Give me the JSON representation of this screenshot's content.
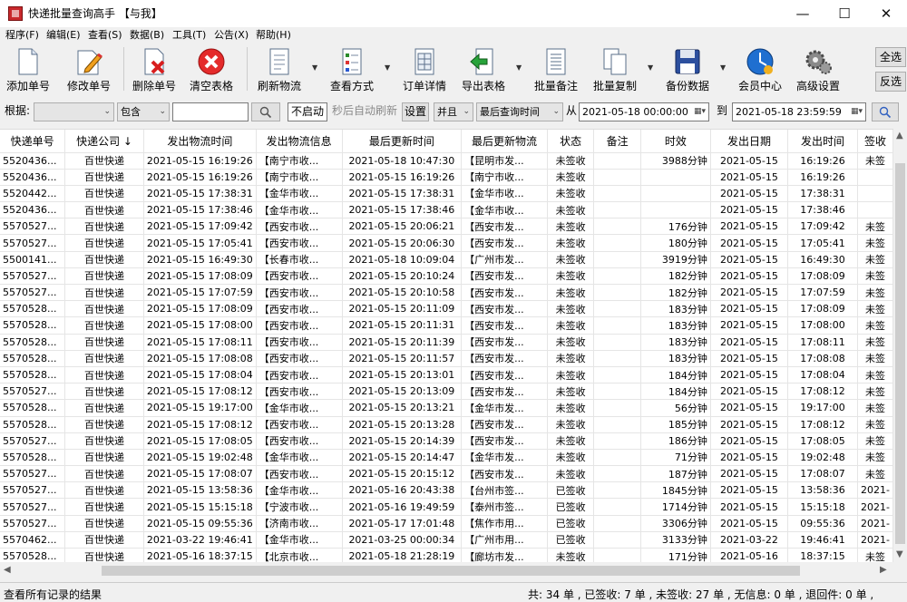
{
  "window": {
    "title": "快递批量查询高手 【与我】",
    "min_glyph": "—",
    "max_glyph": "☐",
    "close_glyph": "✕"
  },
  "menu": [
    "程序(F)",
    "编辑(E)",
    "查看(S)",
    "数据(B)",
    "工具(T)",
    "公告(X)",
    "帮助(H)"
  ],
  "toolbar": {
    "add": "添加单号",
    "edit": "修改单号",
    "delete": "删除单号",
    "clear": "清空表格",
    "refresh": "刷新物流",
    "view_mode": "查看方式",
    "order_detail": "订单详情",
    "export": "导出表格",
    "batch_note": "批量备注",
    "batch_copy": "批量复制",
    "backup": "备份数据",
    "member": "会员中心",
    "advanced": "高级设置",
    "select_all": "全选",
    "invert": "反选"
  },
  "filter": {
    "basis_label": "根据:",
    "basis_value": "",
    "match_value": "包含",
    "keyword_value": "",
    "auto_btn": "不启动",
    "auto_suffix": "秒后自动刷新",
    "settings_btn": "设置",
    "logic_value": "并且",
    "field_value": "最后查询时间",
    "from_label": "从",
    "from_value": "2021-05-18 00:00:00",
    "to_label": "到",
    "to_value": "2021-05-18 23:59:59"
  },
  "table": {
    "columns": [
      "快递单号",
      "快递公司 ↓",
      "发出物流时间",
      "发出物流信息",
      "最后更新时间",
      "最后更新物流",
      "状态",
      "备注",
      "时效",
      "发出日期",
      "发出时间",
      "签收"
    ],
    "rows": [
      [
        "5520436...",
        "百世快递",
        "2021-05-15 16:19:26",
        "【南宁市收...",
        "2021-05-18 10:47:30",
        "【昆明市发...",
        "未签收",
        "",
        "3988分钟",
        "2021-05-15",
        "16:19:26",
        "未签"
      ],
      [
        "5520436...",
        "百世快递",
        "2021-05-15 16:19:26",
        "【南宁市收...",
        "2021-05-15 16:19:26",
        "【南宁市收...",
        "未签收",
        "",
        "",
        "2021-05-15",
        "16:19:26",
        ""
      ],
      [
        "5520442...",
        "百世快递",
        "2021-05-15 17:38:31",
        "【金华市收...",
        "2021-05-15 17:38:31",
        "【金华市收...",
        "未签收",
        "",
        "",
        "2021-05-15",
        "17:38:31",
        ""
      ],
      [
        "5520436...",
        "百世快递",
        "2021-05-15 17:38:46",
        "【金华市收...",
        "2021-05-15 17:38:46",
        "【金华市收...",
        "未签收",
        "",
        "",
        "2021-05-15",
        "17:38:46",
        ""
      ],
      [
        "5570527...",
        "百世快递",
        "2021-05-15 17:09:42",
        "【西安市收...",
        "2021-05-15 20:06:21",
        "【西安市发...",
        "未签收",
        "",
        "176分钟",
        "2021-05-15",
        "17:09:42",
        "未签"
      ],
      [
        "5570527...",
        "百世快递",
        "2021-05-15 17:05:41",
        "【西安市收...",
        "2021-05-15 20:06:30",
        "【西安市发...",
        "未签收",
        "",
        "180分钟",
        "2021-05-15",
        "17:05:41",
        "未签"
      ],
      [
        "5500141...",
        "百世快递",
        "2021-05-15 16:49:30",
        "【长春市收...",
        "2021-05-18 10:09:04",
        "【广州市发...",
        "未签收",
        "",
        "3919分钟",
        "2021-05-15",
        "16:49:30",
        "未签"
      ],
      [
        "5570527...",
        "百世快递",
        "2021-05-15 17:08:09",
        "【西安市收...",
        "2021-05-15 20:10:24",
        "【西安市发...",
        "未签收",
        "",
        "182分钟",
        "2021-05-15",
        "17:08:09",
        "未签"
      ],
      [
        "5570527...",
        "百世快递",
        "2021-05-15 17:07:59",
        "【西安市收...",
        "2021-05-15 20:10:58",
        "【西安市发...",
        "未签收",
        "",
        "182分钟",
        "2021-05-15",
        "17:07:59",
        "未签"
      ],
      [
        "5570528...",
        "百世快递",
        "2021-05-15 17:08:09",
        "【西安市收...",
        "2021-05-15 20:11:09",
        "【西安市发...",
        "未签收",
        "",
        "183分钟",
        "2021-05-15",
        "17:08:09",
        "未签"
      ],
      [
        "5570528...",
        "百世快递",
        "2021-05-15 17:08:00",
        "【西安市收...",
        "2021-05-15 20:11:31",
        "【西安市发...",
        "未签收",
        "",
        "183分钟",
        "2021-05-15",
        "17:08:00",
        "未签"
      ],
      [
        "5570528...",
        "百世快递",
        "2021-05-15 17:08:11",
        "【西安市收...",
        "2021-05-15 20:11:39",
        "【西安市发...",
        "未签收",
        "",
        "183分钟",
        "2021-05-15",
        "17:08:11",
        "未签"
      ],
      [
        "5570528...",
        "百世快递",
        "2021-05-15 17:08:08",
        "【西安市收...",
        "2021-05-15 20:11:57",
        "【西安市发...",
        "未签收",
        "",
        "183分钟",
        "2021-05-15",
        "17:08:08",
        "未签"
      ],
      [
        "5570528...",
        "百世快递",
        "2021-05-15 17:08:04",
        "【西安市收...",
        "2021-05-15 20:13:01",
        "【西安市发...",
        "未签收",
        "",
        "184分钟",
        "2021-05-15",
        "17:08:04",
        "未签"
      ],
      [
        "5570527...",
        "百世快递",
        "2021-05-15 17:08:12",
        "【西安市收...",
        "2021-05-15 20:13:09",
        "【西安市发...",
        "未签收",
        "",
        "184分钟",
        "2021-05-15",
        "17:08:12",
        "未签"
      ],
      [
        "5570528...",
        "百世快递",
        "2021-05-15 19:17:00",
        "【金华市收...",
        "2021-05-15 20:13:21",
        "【金华市发...",
        "未签收",
        "",
        "56分钟",
        "2021-05-15",
        "19:17:00",
        "未签"
      ],
      [
        "5570528...",
        "百世快递",
        "2021-05-15 17:08:12",
        "【西安市收...",
        "2021-05-15 20:13:28",
        "【西安市发...",
        "未签收",
        "",
        "185分钟",
        "2021-05-15",
        "17:08:12",
        "未签"
      ],
      [
        "5570527...",
        "百世快递",
        "2021-05-15 17:08:05",
        "【西安市收...",
        "2021-05-15 20:14:39",
        "【西安市发...",
        "未签收",
        "",
        "186分钟",
        "2021-05-15",
        "17:08:05",
        "未签"
      ],
      [
        "5570528...",
        "百世快递",
        "2021-05-15 19:02:48",
        "【金华市收...",
        "2021-05-15 20:14:47",
        "【金华市发...",
        "未签收",
        "",
        "71分钟",
        "2021-05-15",
        "19:02:48",
        "未签"
      ],
      [
        "5570527...",
        "百世快递",
        "2021-05-15 17:08:07",
        "【西安市收...",
        "2021-05-15 20:15:12",
        "【西安市发...",
        "未签收",
        "",
        "187分钟",
        "2021-05-15",
        "17:08:07",
        "未签"
      ],
      [
        "5570527...",
        "百世快递",
        "2021-05-15 13:58:36",
        "【金华市收...",
        "2021-05-16 20:43:38",
        "【台州市签...",
        "已签收",
        "",
        "1845分钟",
        "2021-05-15",
        "13:58:36",
        "2021-"
      ],
      [
        "5570527...",
        "百世快递",
        "2021-05-15 15:15:18",
        "【宁波市收...",
        "2021-05-16 19:49:59",
        "【泰州市签...",
        "已签收",
        "",
        "1714分钟",
        "2021-05-15",
        "15:15:18",
        "2021-"
      ],
      [
        "5570527...",
        "百世快递",
        "2021-05-15 09:55:36",
        "【济南市收...",
        "2021-05-17 17:01:48",
        "【焦作市用...",
        "已签收",
        "",
        "3306分钟",
        "2021-05-15",
        "09:55:36",
        "2021-"
      ],
      [
        "5570462...",
        "百世快递",
        "2021-03-22 19:46:41",
        "【金华市收...",
        "2021-03-25 00:00:34",
        "【广州市用...",
        "已签收",
        "",
        "3133分钟",
        "2021-03-22",
        "19:46:41",
        "2021-"
      ],
      [
        "5570528...",
        "百世快递",
        "2021-05-16 18:37:15",
        "【北京市收...",
        "2021-05-18 21:28:19",
        "【廊坊市发...",
        "未签收",
        "",
        "171分钟",
        "2021-05-16",
        "18:37:15",
        "未签"
      ]
    ]
  },
  "status": {
    "left": "查看所有记录的结果",
    "right": "共: 34 单 , 已签收: 7 单 , 未签收: 27 单 , 无信息: 0 单 , 退回件: 0 单 ,"
  }
}
